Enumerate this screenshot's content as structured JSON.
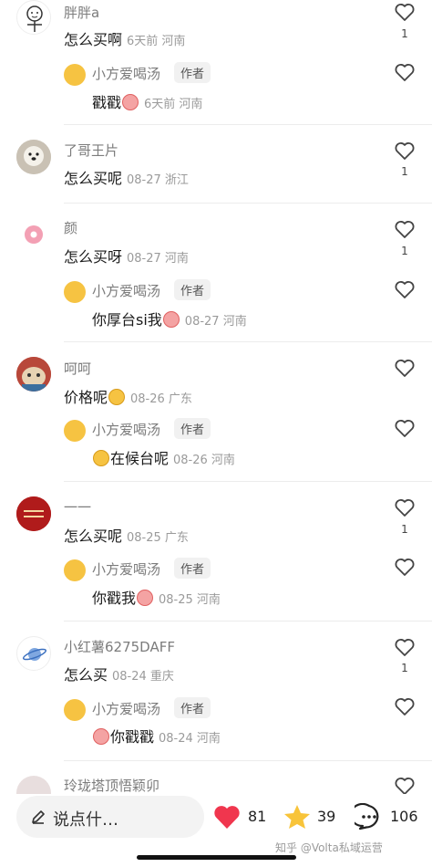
{
  "comments": [
    {
      "user": "胖胖a",
      "text": "怎么买啊",
      "meta": "6天前 河南",
      "likes": "1",
      "avatar": "doodle",
      "reply": {
        "user": "小方爱喝汤",
        "tag": "作者",
        "text": "戳戳",
        "meta": "6天前 河南"
      }
    },
    {
      "user": "了哥王片",
      "text": "怎么买呢",
      "meta": "08-27 浙江",
      "likes": "1",
      "avatar": "dog"
    },
    {
      "user": "颜",
      "text": "怎么买呀",
      "meta": "08-27 河南",
      "likes": "1",
      "avatar": "donut",
      "reply": {
        "user": "小方爱喝汤",
        "tag": "作者",
        "text": "你厚台si我",
        "meta": "08-27 河南"
      }
    },
    {
      "user": "呵呵",
      "text": "价格呢",
      "meta": "08-26 广东",
      "likes": "",
      "avatar": "cat",
      "reply": {
        "user": "小方爱喝汤",
        "tag": "作者",
        "text": "在候台呢",
        "meta": "08-26 河南"
      }
    },
    {
      "user": "一一",
      "text": "怎么买呢",
      "meta": "08-25 广东",
      "likes": "1",
      "avatar": "red",
      "reply": {
        "user": "小方爱喝汤",
        "tag": "作者",
        "text": "你戳我",
        "meta": "08-25 河南"
      }
    },
    {
      "user": "小红薯6275DAFF",
      "text": "怎么买",
      "meta": "08-24 重庆",
      "likes": "1",
      "avatar": "planet",
      "reply": {
        "user": "小方爱喝汤",
        "tag": "作者",
        "text": "你戳戳",
        "meta": "08-24 河南"
      }
    },
    {
      "user": "玲珑塔顶悟颖卯",
      "avatar": "partial"
    }
  ],
  "bottom_bar": {
    "input_placeholder": "说点什…",
    "likes": "81",
    "favorites": "39",
    "comments": "106"
  },
  "watermark": "知乎 @Volta私域运营",
  "colors": {
    "like_red": "#f0364e",
    "star_yellow": "#f8c43a",
    "meta_gray": "#9a9a9a"
  }
}
